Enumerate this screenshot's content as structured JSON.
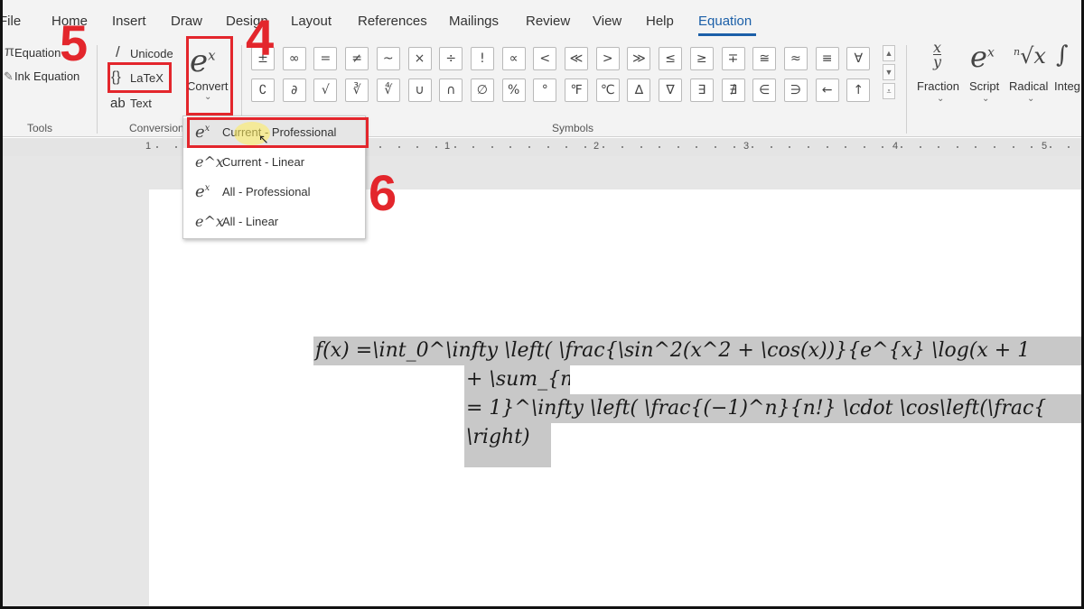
{
  "tabs": [
    "File",
    "Home",
    "Insert",
    "Draw",
    "Design",
    "Layout",
    "References",
    "Mailings",
    "Review",
    "View",
    "Help",
    "Equation"
  ],
  "tools": {
    "equation_label": "Equation",
    "ink_label": "Ink Equation",
    "group_label": "Tools"
  },
  "conversions": {
    "unicode_label": "Unicode",
    "latex_label": "LaTeX",
    "text_label": "Text",
    "group_label": "Conversions"
  },
  "convert": {
    "glyph": "e",
    "superscript": "x",
    "label": "Convert",
    "chevron": "⌄"
  },
  "symbols": {
    "group_label": "Symbols",
    "row1": [
      "±",
      "∞",
      "=",
      "≠",
      "~",
      "×",
      "÷",
      "!",
      "∝",
      "<",
      "≪",
      ">",
      "≫",
      "≤",
      "≥",
      "∓",
      "≅",
      "≈",
      "≡",
      "∀"
    ],
    "row2": [
      "∁",
      "∂",
      "√",
      "∛",
      "∜",
      "∪",
      "∩",
      "∅",
      "%",
      "°",
      "℉",
      "℃",
      "∆",
      "∇",
      "∃",
      "∄",
      "∈",
      "∋",
      "←",
      "↑"
    ]
  },
  "structures": [
    {
      "name": "Fraction",
      "glyph": "x/y"
    },
    {
      "name": "Script",
      "glyph": "eˣ"
    },
    {
      "name": "Radical",
      "glyph": "ⁿ√x"
    },
    {
      "name": "Integral",
      "glyph": "∫"
    }
  ],
  "ruler_numbers": [
    "1",
    "1",
    "2",
    "3",
    "4",
    "5"
  ],
  "dropdown": [
    {
      "label": "Current - Professional",
      "icon": "eˣ"
    },
    {
      "label": "Current - Linear",
      "icon": "e^x"
    },
    {
      "label": "All - Professional",
      "icon": "eˣ"
    },
    {
      "label": "All - Linear",
      "icon": "e^x"
    }
  ],
  "equation_lines": [
    "f(x)  =\\int_0^\\infty \\left( \\frac{\\sin^2(x^2 + \\cos(x))}{e^{x} \\log(x + 1",
    "+ \\sum_{n",
    "= 1}^\\infty \\left( \\frac{(−1)^n}{n!} \\cdot \\cos\\left(\\frac{",
    "\\right)"
  ],
  "callouts": {
    "step4": "4",
    "step5": "5",
    "step6": "6"
  },
  "colors": {
    "accent": "#1b5fa8",
    "callout": "#e3262c",
    "highlight": "#c8c8c8"
  }
}
